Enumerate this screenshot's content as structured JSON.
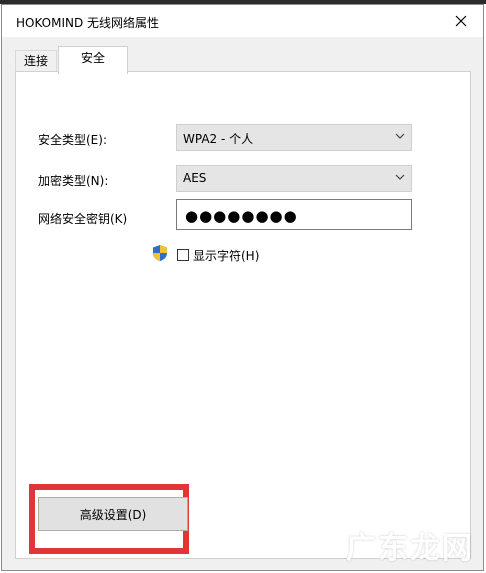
{
  "window": {
    "title": "HOKOMIND 无线网络属性"
  },
  "tabs": [
    {
      "label": "连接",
      "active": false
    },
    {
      "label": "安全",
      "active": true
    }
  ],
  "security": {
    "type_label": "安全类型(E):",
    "type_value": "WPA2 - 个人",
    "encryption_label": "加密类型(N):",
    "encryption_value": "AES",
    "key_label": "网络安全密钥(K)",
    "key_value": "●●●●●●●●",
    "show_chars_label": "显示字符(H)",
    "show_chars_checked": false
  },
  "advanced_button": {
    "label": "高级设置(D)"
  },
  "watermark": "广东龙网",
  "colors": {
    "highlight": "#e0363a",
    "panel_bg": "#ffffff",
    "window_bg": "#f0f0f0"
  },
  "icons": [
    "close-icon",
    "chevron-down-icon",
    "shield-icon",
    "checkbox"
  ]
}
